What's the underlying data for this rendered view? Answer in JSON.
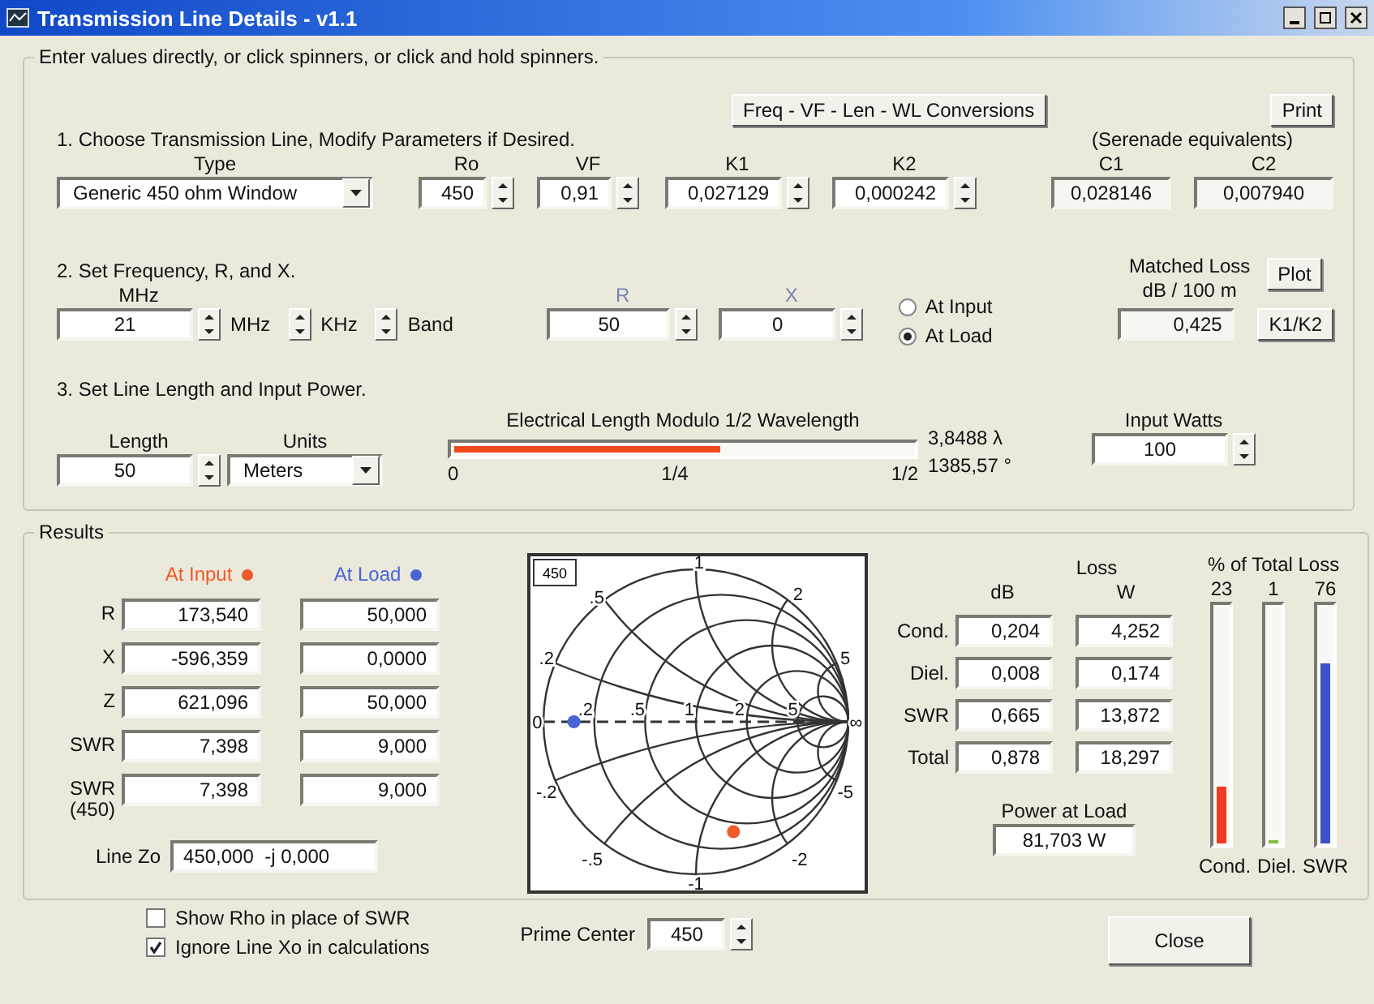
{
  "window": {
    "title": "Transmission Line Details - v1.1"
  },
  "inputs": {
    "legend": "Enter values directly, or click spinners, or click and hold spinners.",
    "conversions_button": "Freq - VF - Len - WL Conversions",
    "print_button": "Print",
    "section1": {
      "title": "1. Choose Transmission Line, Modify Parameters if Desired.",
      "type": {
        "label": "Type",
        "value": "Generic 450 ohm Window"
      },
      "params": [
        {
          "label": "Ro",
          "value": "450"
        },
        {
          "label": "VF",
          "value": "0,91"
        },
        {
          "label": "K1",
          "value": "0,027129"
        },
        {
          "label": "K2",
          "value": "0,000242"
        }
      ],
      "serenade": {
        "title": "(Serenade equivalents)",
        "fields": [
          {
            "label": "C1",
            "value": "0,028146"
          },
          {
            "label": "C2",
            "value": "0,007940"
          }
        ]
      }
    },
    "section2": {
      "title": "2. Set Frequency, R, and X.",
      "freq": {
        "label": "MHz",
        "value": "21"
      },
      "steps": [
        "MHz",
        "KHz",
        "Band"
      ],
      "impedance": [
        {
          "label": "R",
          "value": "50"
        },
        {
          "label": "X",
          "value": "0"
        }
      ],
      "radios": [
        {
          "label": "At Input",
          "selected": false
        },
        {
          "label": "At Load",
          "selected": true
        }
      ],
      "matched_loss": {
        "title": "Matched Loss",
        "unit": "dB / 100 m",
        "value": "0,425"
      },
      "plot_button": "Plot",
      "k_button": "K1/K2"
    },
    "section3": {
      "title": "3. Set Line Length and Input Power.",
      "length": {
        "label": "Length",
        "value": "50"
      },
      "units": {
        "label": "Units",
        "value": "Meters"
      },
      "electrical_length": {
        "title": "Electrical Length Modulo 1/2 Wavelength",
        "level": 0.58,
        "ticks": [
          "0",
          "1/4",
          "1/2"
        ],
        "readings": [
          "3,8488 λ",
          "1385,57 °"
        ]
      },
      "watts": {
        "label": "Input Watts",
        "value": "100"
      }
    }
  },
  "results": {
    "legend": "Results",
    "columns": [
      {
        "label": "At Input",
        "color": "#f05a28"
      },
      {
        "label": "At Load",
        "color": "#4a64d8"
      }
    ],
    "rows": [
      {
        "label": "R",
        "values": [
          "173,540",
          "50,000"
        ]
      },
      {
        "label": "X",
        "values": [
          "-596,359",
          "0,0000"
        ]
      },
      {
        "label": "Z",
        "values": [
          "621,096",
          "50,000"
        ]
      },
      {
        "label": "SWR",
        "values": [
          "7,398",
          "9,000"
        ]
      },
      {
        "label": "SWR (450)",
        "values": [
          "7,398",
          "9,000"
        ]
      }
    ],
    "line_zo": {
      "label": "Line Zo",
      "value": "450,000  -j 0,000"
    },
    "smith_chart": {
      "badge": "450",
      "labels": [
        ".5",
        "1",
        "2",
        ".2",
        "5",
        "0",
        ".2",
        ".5",
        "1",
        "2",
        "5",
        "∞",
        "-.2",
        "-.5",
        "-1",
        "-2",
        "-5"
      ]
    },
    "loss": {
      "title": "Loss",
      "columns": [
        "dB",
        "W"
      ],
      "rows": [
        {
          "label": "Cond.",
          "values": [
            "0,204",
            "4,252"
          ]
        },
        {
          "label": "Diel.",
          "values": [
            "0,008",
            "0,174"
          ]
        },
        {
          "label": "SWR",
          "values": [
            "0,665",
            "13,872"
          ]
        },
        {
          "label": "Total",
          "values": [
            "0,878",
            "18,297"
          ]
        }
      ]
    },
    "power_at_load": {
      "label": "Power at Load",
      "value": "81,703 W"
    },
    "loss_share": {
      "title": "% of Total Loss",
      "bars": [
        {
          "label": "Cond.",
          "value": "23",
          "level": 0.24,
          "color": "#f03c20"
        },
        {
          "label": "Diel.",
          "value": "1",
          "level": 0.01,
          "color": "#80c040"
        },
        {
          "label": "SWR",
          "value": "76",
          "level": 0.76,
          "color": "#4050c8"
        }
      ]
    }
  },
  "options": [
    {
      "label": "Show Rho in place of SWR",
      "checked": false
    },
    {
      "label": "Ignore Line Xo in calculations",
      "checked": true
    }
  ],
  "prime_center": {
    "label": "Prime Center",
    "value": "450"
  },
  "close_button": "Close"
}
